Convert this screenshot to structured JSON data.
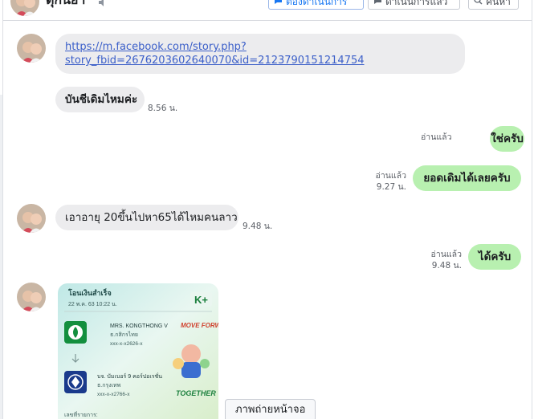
{
  "header": {
    "contact_name": "ตุ๊กนิ่ยา",
    "btn_follow_up": "ต้องดำเนินการ",
    "btn_done": "ดำเนินการแล้ว",
    "btn_search": "ค้นหา"
  },
  "messages": [
    {
      "type": "incoming",
      "link_line1": "https://m.facebook.com/story.php?",
      "link_line2": "story_fbid=2676203602640070&id=2123790151214754"
    },
    {
      "type": "incoming",
      "text": "บันชีเดิมไหมค่ะ",
      "time": "8.56 น."
    },
    {
      "type": "outgoing",
      "text": "ใช่ครับ",
      "status": "อ่านแล้ว"
    },
    {
      "type": "outgoing",
      "text": "ยอดเดิมได้เลยครับ",
      "status": "อ่านแล้ว",
      "time": "9.27 น."
    },
    {
      "type": "incoming",
      "text": "เอาอายุ 20ขึ้นไปหา65ได้ไหมคนลาว",
      "time": "9.48 น."
    },
    {
      "type": "outgoing",
      "text": "ได้ครับ",
      "status": "อ่านแล้ว",
      "time": "9.48 น."
    },
    {
      "type": "incoming-image",
      "caption": "ภาพถ่ายหน้าจอ"
    }
  ],
  "receipt": {
    "title": "โอนเงินสำเร็จ",
    "date": "22 พ.ค. 63  10:22 น.",
    "brand": "K+",
    "from_name": "MRS. KONGTHONG V",
    "from_bank": "ธ.กสิกรไทย",
    "from_acct": "xxx-x-x2626-x",
    "to_name": "บจ. บัมเบอร์ 9 คอร์ปอเรชั่น",
    "to_bank": "ธ.กรุงเทพ",
    "to_acct": "xxx-x-x2766-x",
    "memo": "เลขที่รายการ:",
    "promo_top": "MOVE FORWARD",
    "promo_bottom": "TOGETHER"
  },
  "colors": {
    "incoming_bubble": "#ececee",
    "outgoing_bubble": "#b8f0b0",
    "link": "#3b5fc9",
    "accent": "#1877f2"
  }
}
